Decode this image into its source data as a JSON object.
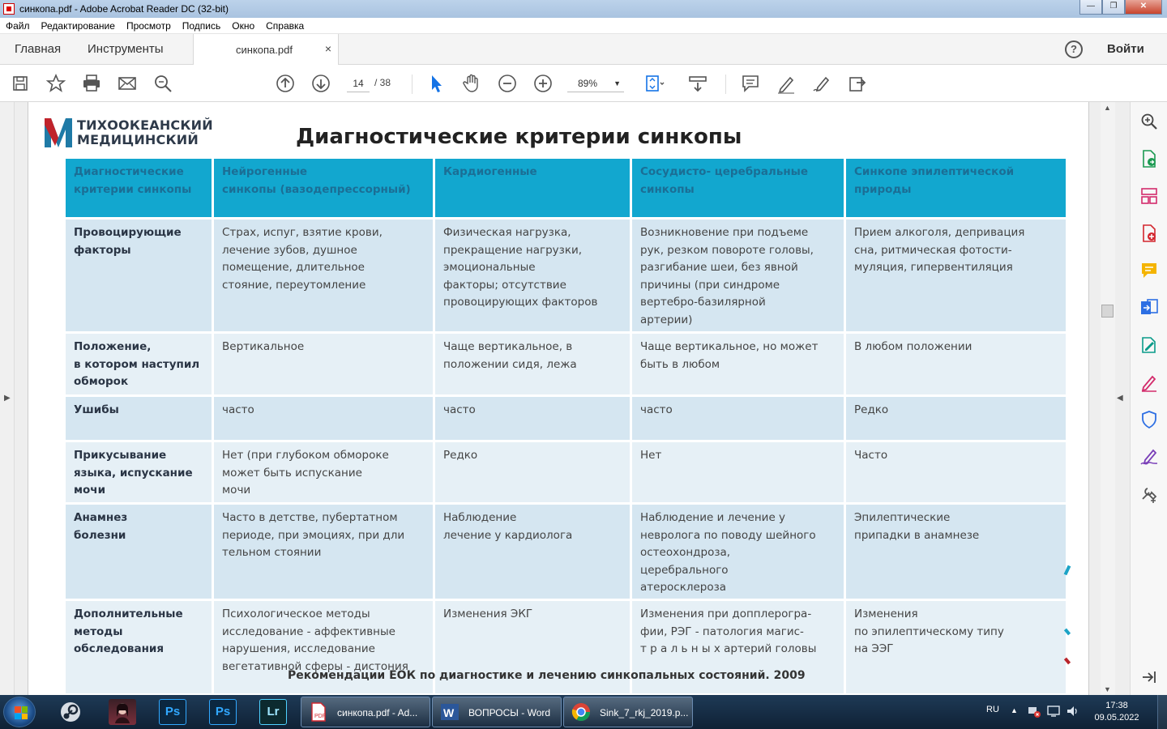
{
  "window": {
    "title": "синкопа.pdf - Adobe Acrobat Reader DC (32-bit)",
    "minimize": "—",
    "maximize": "❐",
    "close": "✕"
  },
  "menu": [
    "Файл",
    "Редактирование",
    "Просмотр",
    "Подпись",
    "Окно",
    "Справка"
  ],
  "tabs": {
    "home": "Главная",
    "tools": "Инструменты",
    "document": "синкопа.pdf",
    "close": "×",
    "help": "?",
    "signin": "Войти"
  },
  "toolbar": {
    "page_current": "14",
    "page_total": "/ 38",
    "zoom": "89%",
    "zoom_dropdown": "▼"
  },
  "icons": {
    "toolbar": [
      "save-icon",
      "star-icon",
      "print-icon",
      "mail-icon",
      "search-zoom-icon",
      "page-up-icon",
      "page-down-icon",
      "select-arrow-icon",
      "hand-icon",
      "zoom-out-icon",
      "zoom-in-icon",
      "fit-page-icon",
      "scroll-mode-icon",
      "comment-icon",
      "highlight-pen-icon",
      "draw-sign-icon",
      "share-icon"
    ],
    "right_panel": [
      "zoom-search-icon",
      "export-pdf-icon",
      "organize-pages-icon",
      "create-pdf-icon",
      "comment-tool-icon",
      "combine-files-icon",
      "edit-pdf-icon",
      "fill-sign-icon",
      "protect-icon",
      "sign-icon",
      "more-tools-icon",
      "expand-panel-icon"
    ]
  },
  "slide": {
    "logo_line1": "ТИХООКЕАНСКИЙ",
    "logo_line2": "МЕДИЦИНСКИЙ",
    "title": "Диагностические  критерии синкопы",
    "citation": "Рекомендации ЕОК по диагностике и лечению  синкопальных состояний. 2009",
    "headers": [
      "Диагностические\n критерии синкопы",
      "Нейрогенные\nсинкопы (вазодепрессорный)",
      "Кардиогенные",
      "Сосудисто- церебральные\nсинкопы",
      "Синкопе эпилептической\nприроды"
    ],
    "rows": [
      [
        "Провоцирующие\nфакторы",
        "Страх, испуг, взятие крови,\nлечение зубов, душное\nпомещение, длительное\nстояние, переутомление",
        "Физическая нагрузка,\nпрекращение нагрузки,\nэмоциональные\n факторы; отсутствие\nпровоцирующих факторов",
        "Возникновение при подъеме\nрук, резком повороте головы,\nразгибание шеи, без явной\nпричины (при синдроме\nвертебро-базилярной\nартерии)",
        "Прием алкоголя, депривация\nсна,  ритмическая фотости-\nмуляция, гипервентиляция"
      ],
      [
        "Положение,\nв котором наступил\nобморок",
        "Вертикальное",
        "Чаще вертикальное, в\nположении сидя, лежа",
        "Чаще вертикальное, но может\nбыть в любом",
        "В любом положении"
      ],
      [
        "Ушибы",
        "часто",
        "часто",
        "часто",
        "Редко"
      ],
      [
        "Прикусывание\nязыка, испускание\nмочи",
        "Нет (при глубоком обмороке\nможет быть испускание\nмочи",
        "Редко",
        "Нет",
        "Часто"
      ],
      [
        "Анамнез\nболезни",
        "Часто в детстве, пубертатном\nпериоде, при эмоциях, при дли\nтельном стоянии",
        "Наблюдение\nлечение у кардиолога",
        "Наблюдение и лечение у\nневролога по поводу шейного\nостеохондроза,\nцеребрального\nатеросклероза",
        "Эпилептические\nприпадки в анамнезе"
      ],
      [
        "Дополнительные\nметоды\nобследования",
        "Психологическое  методы\nисследование - аффективные\nнарушения, исследование\nвегетативной сферы - дистония",
        "Изменения ЭКГ",
        "Изменения при допплерогра-\nфии, РЭГ - патология магис-\nт р а л ь н ы х артерий головы",
        "Изменения\nпо эпилептическому типу\nна ЭЭГ"
      ]
    ]
  },
  "taskbar": {
    "items": [
      {
        "label": "синкопа.pdf - Ad...",
        "icon": "acrobat-icon"
      },
      {
        "label": "ВОПРОСЫ - Word",
        "icon": "word-icon"
      },
      {
        "label": "Sink_7_rkj_2019.p...",
        "icon": "chrome-icon"
      }
    ],
    "pinned": [
      "Ps",
      "Ps",
      "Lr"
    ],
    "lang": "RU",
    "time": "17:38",
    "date": "09.05.2022"
  },
  "colors": {
    "header_cell": "#12a7cf",
    "row_odd": "#d5e6f1",
    "row_even": "#e6f0f6",
    "acrobat_red": "#d3272f",
    "taskbar": "#1e3a56"
  }
}
